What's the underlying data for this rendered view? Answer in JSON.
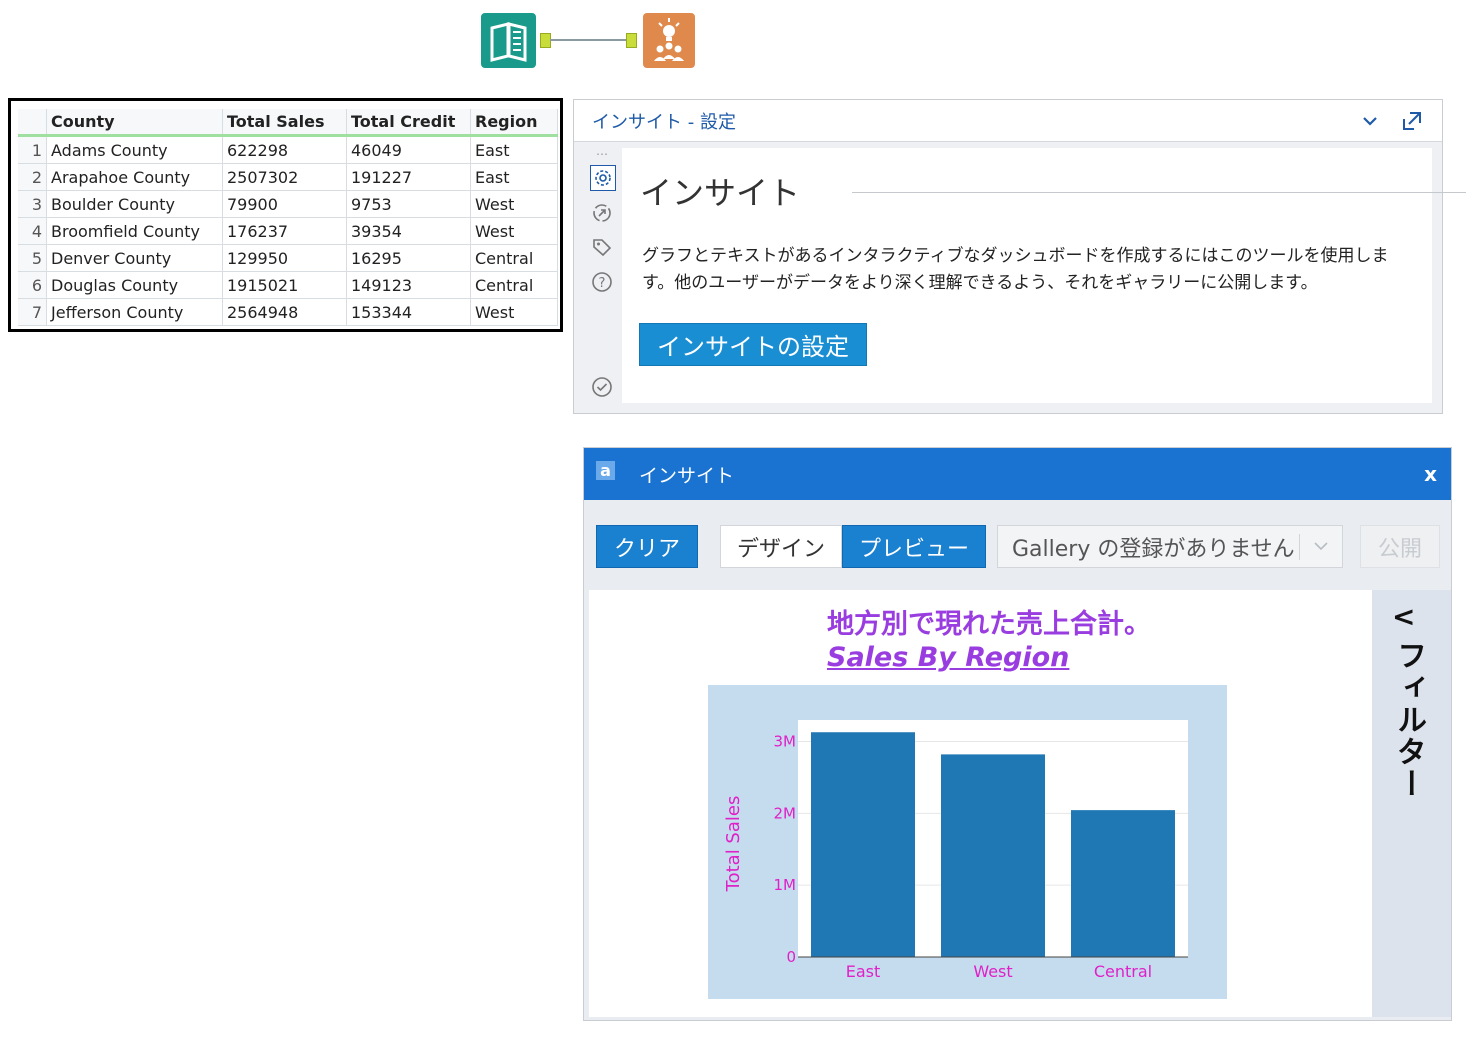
{
  "workflow": {
    "input_tool_icon": "book-icon",
    "insight_tool_icon": "insight-lightbulb-icon",
    "input_tool_color": "#1a9a8a",
    "insight_tool_color": "#e0894c"
  },
  "grid": {
    "headers": [
      "County",
      "Total Sales",
      "Total Credit",
      "Region"
    ],
    "rows": [
      {
        "n": "1",
        "county": "Adams County",
        "sales": "622298",
        "credit": "46049",
        "region": "East"
      },
      {
        "n": "2",
        "county": "Arapahoe County",
        "sales": "2507302",
        "credit": "191227",
        "region": "East"
      },
      {
        "n": "3",
        "county": "Boulder County",
        "sales": "79900",
        "credit": "9753",
        "region": "West"
      },
      {
        "n": "4",
        "county": "Broomfield County",
        "sales": "176237",
        "credit": "39354",
        "region": "West"
      },
      {
        "n": "5",
        "county": "Denver County",
        "sales": "129950",
        "credit": "16295",
        "region": "Central"
      },
      {
        "n": "6",
        "county": "Douglas County",
        "sales": "1915021",
        "credit": "149123",
        "region": "Central"
      },
      {
        "n": "7",
        "county": "Jefferson County",
        "sales": "2564948",
        "credit": "153344",
        "region": "West"
      }
    ]
  },
  "config": {
    "title": "インサイト - 設定",
    "heading": "インサイト",
    "description": "グラフとテキストがあるインタラクティブなダッシュボードを作成するにはこのツールを使用します。他のユーザーがデータをより深く理解できるよう、それをギャラリーに公開します。",
    "button": "インサイトの設定",
    "sidebar_icons": [
      "gear-icon",
      "annotation-icon",
      "tag-icon",
      "help-icon",
      "check-circle-icon"
    ],
    "accent": "#1a8ed3"
  },
  "dialog": {
    "title": "インサイト",
    "logo": "a",
    "close": "x",
    "clear": "クリア",
    "design": "デザイン",
    "preview": "プレビュー",
    "gallery": "Gallery の登録がありません",
    "publish": "公開",
    "titlebar_color": "#1a73d0",
    "filter_label": "フィルター",
    "filter_chevron": "<"
  },
  "chart": {
    "title": "地方別で現れた売上合計。",
    "subtitle": "Sales By Region"
  },
  "chart_data": {
    "type": "bar",
    "title": "Sales By Region",
    "categories": [
      "East",
      "West",
      "Central"
    ],
    "series": [
      {
        "values": [
          3129600,
          2821085,
          2044971
        ]
      }
    ],
    "ylabel": "Total Sales",
    "xlabel": "",
    "ylim": [
      0,
      3300000
    ],
    "yticks": [
      {
        "value": 0,
        "label": "0"
      },
      {
        "value": 1000000,
        "label": "1M"
      },
      {
        "value": 2000000,
        "label": "2M"
      },
      {
        "value": 3000000,
        "label": "3M"
      }
    ],
    "grid": true,
    "bar_color": "#1f77b4",
    "label_color": "#e020c8",
    "plot_background": "#ffffff",
    "paper_background": "#c4dced"
  }
}
